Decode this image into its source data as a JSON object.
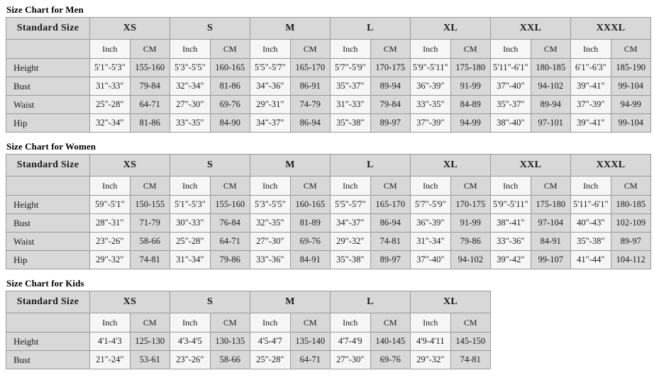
{
  "charts": [
    {
      "title": "Size Chart for Men",
      "standard_size_label": "Standard Size",
      "sizes": [
        "XS",
        "S",
        "M",
        "L",
        "XL",
        "XXL",
        "XXXL"
      ],
      "units": [
        "Inch",
        "CM"
      ],
      "row_labels": [
        "Height",
        "Bust",
        "Waist",
        "Hip"
      ],
      "rows": [
        {
          "label": "Height",
          "values": [
            "5'1\"-5'3\"",
            "155-160",
            "5'3\"-5'5\"",
            "160-165",
            "5'5\"-5'7\"",
            "165-170",
            "5'7\"-5'9\"",
            "170-175",
            "5'9\"-5'11\"",
            "175-180",
            "5'11\"-6'1\"",
            "180-185",
            "6'1\"-6'3\"",
            "185-190"
          ]
        },
        {
          "label": "Bust",
          "values": [
            "31\"-33\"",
            "79-84",
            "32\"-34\"",
            "81-86",
            "34\"-36\"",
            "86-91",
            "35\"-37\"",
            "89-94",
            "36\"-39\"",
            "91-99",
            "37\"-40\"",
            "94-102",
            "39\"-41\"",
            "99-104"
          ]
        },
        {
          "label": "Waist",
          "values": [
            "25\"-28\"",
            "64-71",
            "27\"-30\"",
            "69-76",
            "29\"-31\"",
            "74-79",
            "31\"-33\"",
            "79-84",
            "33\"-35\"",
            "84-89",
            "35\"-37\"",
            "89-94",
            "37\"-39\"",
            "94-99"
          ]
        },
        {
          "label": "Hip",
          "values": [
            "32\"-34\"",
            "81-86",
            "33\"-35\"",
            "84-90",
            "34\"-37\"",
            "86-94",
            "35\"-38\"",
            "89-97",
            "37\"-39\"",
            "94-99",
            "38\"-40\"",
            "97-101",
            "39\"-41\"",
            "99-104"
          ]
        }
      ]
    },
    {
      "title": "Size Chart for Women",
      "standard_size_label": "Standard Size",
      "sizes": [
        "XS",
        "S",
        "M",
        "L",
        "XL",
        "XXL",
        "XXXL"
      ],
      "units": [
        "Inch",
        "CM"
      ],
      "row_labels": [
        "Height",
        "Bust",
        "Waist",
        "Hip"
      ],
      "rows": [
        {
          "label": "Height",
          "values": [
            "59\"-5'1\"",
            "150-155",
            "5'1\"-5'3\"",
            "155-160",
            "5'3\"-5'5\"",
            "160-165",
            "5'5\"-5'7\"",
            "165-170",
            "5'7\"-5'9\"",
            "170-175",
            "5'9\"-5'11\"",
            "175-180",
            "5'11\"-6'1\"",
            "180-185"
          ]
        },
        {
          "label": "Bust",
          "values": [
            "28\"-31\"",
            "71-79",
            "30\"-33\"",
            "76-84",
            "32\"-35\"",
            "81-89",
            "34\"-37\"",
            "86-94",
            "36\"-39\"",
            "91-99",
            "38\"-41\"",
            "97-104",
            "40\"-43\"",
            "102-109"
          ]
        },
        {
          "label": "Waist",
          "values": [
            "23\"-26\"",
            "58-66",
            "25\"-28\"",
            "64-71",
            "27\"-30\"",
            "69-76",
            "29\"-32\"",
            "74-81",
            "31\"-34\"",
            "79-86",
            "33\"-36\"",
            "84-91",
            "35\"-38\"",
            "89-97"
          ]
        },
        {
          "label": "Hip",
          "values": [
            "29\"-32\"",
            "74-81",
            "31\"-34\"",
            "79-86",
            "33\"-36\"",
            "84-91",
            "35\"-38\"",
            "89-97",
            "37\"-40\"",
            "94-102",
            "39\"-42\"",
            "99-107",
            "41\"-44\"",
            "104-112"
          ]
        }
      ]
    },
    {
      "title": "Size Chart for Kids",
      "standard_size_label": "Standard Size",
      "sizes": [
        "XS",
        "S",
        "M",
        "L",
        "XL"
      ],
      "units": [
        "Inch",
        "CM"
      ],
      "row_labels": [
        "Height",
        "Bust"
      ],
      "rows": [
        {
          "label": "Height",
          "values": [
            "4'1-4'3",
            "125-130",
            "4'3-4'5",
            "130-135",
            "4'5-4'7",
            "135-140",
            "4'7-4'9",
            "140-145",
            "4'9-4'11",
            "145-150"
          ]
        },
        {
          "label": "Bust",
          "values": [
            "21\"-24\"",
            "53-61",
            "23\"-26\"",
            "58-66",
            "25\"-28\"",
            "64-71",
            "27\"-30\"",
            "69-76",
            "29\"-32\"",
            "74-81"
          ]
        }
      ]
    }
  ],
  "colors": {
    "cell_dark": "#d8d8d8",
    "cell_light": "#f6f6f6",
    "border": "#9a9a9a",
    "text": "#1a1a1a",
    "background": "#ffffff"
  }
}
